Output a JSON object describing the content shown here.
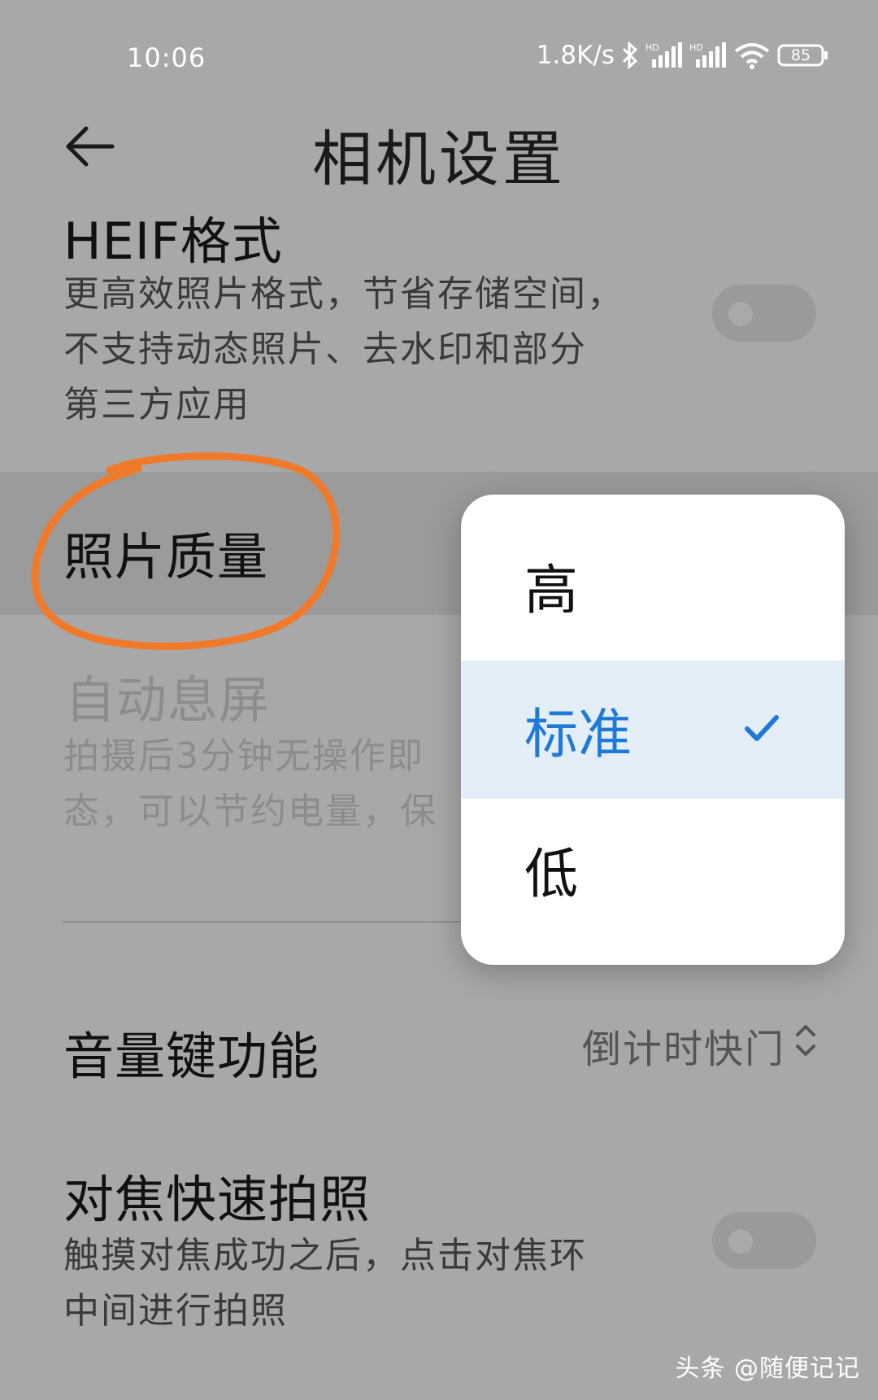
{
  "status_bar": {
    "time": "10:06",
    "network_speed": "1.8K/s",
    "battery": "85",
    "icons": [
      "bluetooth-icon",
      "signal-hd-icon",
      "signal-hd-icon",
      "wifi-icon",
      "battery-icon"
    ]
  },
  "header": {
    "title": "相机设置",
    "back_icon": "back-arrow-icon"
  },
  "settings": {
    "heif": {
      "title": "HEIF格式",
      "desc": [
        "更高效照片格式，节省存储空间，",
        "不支持动态照片、去水印和部分",
        "第三方应用"
      ],
      "toggle_on": false
    },
    "photo_quality": {
      "title": "照片质量"
    },
    "auto_screen_off": {
      "title": "自动息屏",
      "desc": [
        "拍摄后3分钟无操作即",
        "态，可以节约电量，保"
      ]
    },
    "volume_key": {
      "title": "音量键功能",
      "value": "倒计时快门"
    },
    "focus_shoot": {
      "title": "对焦快速拍照",
      "desc": [
        "触摸对焦成功之后，点击对焦环",
        "中间进行拍照"
      ],
      "toggle_on": false
    }
  },
  "quality_popup": {
    "options": [
      {
        "label": "高",
        "selected": false
      },
      {
        "label": "标准",
        "selected": true
      },
      {
        "label": "低",
        "selected": false
      }
    ],
    "selected_color": "#1e7ad6"
  },
  "annotation_color": "#f07a2a",
  "watermark": "头条 @随便记记"
}
